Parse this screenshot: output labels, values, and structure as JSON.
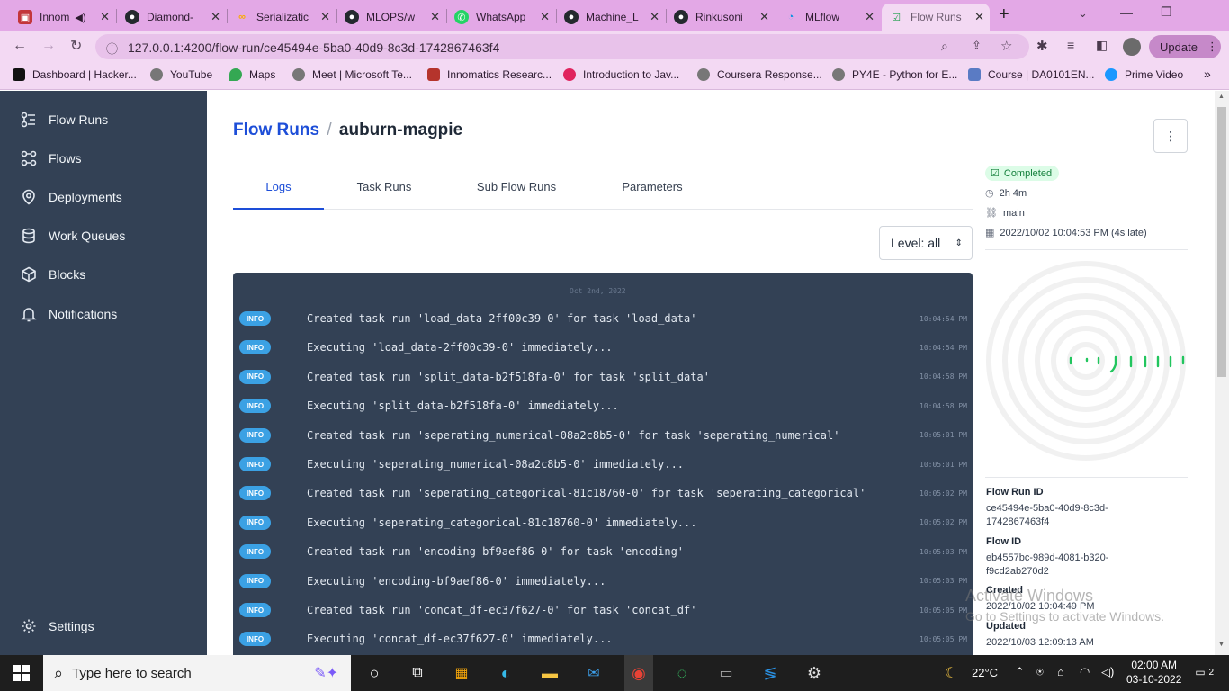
{
  "browser": {
    "tabs": [
      {
        "label": "Innom",
        "icon": "hackerrank-icon"
      },
      {
        "label": "Diamond-",
        "icon": "github-icon"
      },
      {
        "label": "Serializatic",
        "icon": "colab-icon"
      },
      {
        "label": "MLOPS/w",
        "icon": "github-icon"
      },
      {
        "label": "WhatsApp",
        "icon": "whatsapp-icon"
      },
      {
        "label": "Machine_L",
        "icon": "github-icon"
      },
      {
        "label": "Rinkusoni",
        "icon": "github-icon"
      },
      {
        "label": "MLflow",
        "icon": "mlflow-icon"
      },
      {
        "label": "Flow Runs",
        "icon": "prefect-icon"
      }
    ],
    "new_tab": "+",
    "url": "127.0.0.1:4200/flow-run/ce45494e-5ba0-40d9-8c3d-1742867463f4",
    "update_label": "Update",
    "bookmarks": [
      "Dashboard | Hacker...",
      "YouTube",
      "Maps",
      "Meet | Microsoft Te...",
      "Innomatics Researc...",
      "Introduction to Jav...",
      "Coursera Response...",
      "PY4E - Python for E...",
      "Course | DA0101EN...",
      "Prime Video"
    ],
    "bookmarks_more": "»"
  },
  "sidebar": {
    "items": [
      {
        "label": "Flow Runs",
        "icon": "flow-runs-icon"
      },
      {
        "label": "Flows",
        "icon": "flows-icon"
      },
      {
        "label": "Deployments",
        "icon": "deployments-icon"
      },
      {
        "label": "Work Queues",
        "icon": "work-queues-icon"
      },
      {
        "label": "Blocks",
        "icon": "blocks-icon"
      },
      {
        "label": "Notifications",
        "icon": "bell-icon"
      }
    ],
    "settings_label": "Settings"
  },
  "page": {
    "breadcrumb_root": "Flow Runs",
    "breadcrumb_sep": "/",
    "run_name": "auburn-magpie",
    "menu_icon": "⋮",
    "tabs": [
      "Logs",
      "Task Runs",
      "Sub Flow Runs",
      "Parameters"
    ],
    "level_select": "Level: all",
    "log_date": "Oct 2nd, 2022",
    "logs": [
      {
        "level": "INFO",
        "message": "Created task run 'load_data-2ff00c39-0' for task 'load_data'",
        "time": "10:04:54 PM"
      },
      {
        "level": "INFO",
        "message": "Executing 'load_data-2ff00c39-0' immediately...",
        "time": "10:04:54 PM"
      },
      {
        "level": "INFO",
        "message": "Created task run 'split_data-b2f518fa-0' for task 'split_data'",
        "time": "10:04:58 PM"
      },
      {
        "level": "INFO",
        "message": "Executing 'split_data-b2f518fa-0' immediately...",
        "time": "10:04:58 PM"
      },
      {
        "level": "INFO",
        "message": "Created task run 'seperating_numerical-08a2c8b5-0' for task 'seperating_numerical'",
        "time": "10:05:01 PM"
      },
      {
        "level": "INFO",
        "message": "Executing 'seperating_numerical-08a2c8b5-0' immediately...",
        "time": "10:05:01 PM"
      },
      {
        "level": "INFO",
        "message": "Created task run 'seperating_categorical-81c18760-0' for task 'seperating_categorical'",
        "time": "10:05:02 PM"
      },
      {
        "level": "INFO",
        "message": "Executing 'seperating_categorical-81c18760-0' immediately...",
        "time": "10:05:02 PM"
      },
      {
        "level": "INFO",
        "message": "Created task run 'encoding-bf9aef86-0' for task 'encoding'",
        "time": "10:05:03 PM"
      },
      {
        "level": "INFO",
        "message": "Executing 'encoding-bf9aef86-0' immediately...",
        "time": "10:05:03 PM"
      },
      {
        "level": "INFO",
        "message": "Created task run 'concat_df-ec37f627-0' for task 'concat_df'",
        "time": "10:05:05 PM"
      },
      {
        "level": "INFO",
        "message": "Executing 'concat_df-ec37f627-0' immediately...",
        "time": "10:05:05 PM"
      }
    ],
    "details": {
      "status": "Completed",
      "duration": "2h 4m",
      "work_queue": "main",
      "scheduled": "2022/10/02 10:04:53 PM (4s late)",
      "flow_run_id_label": "Flow Run ID",
      "flow_run_id_line1": "ce45494e-5ba0-40d9-8c3d-",
      "flow_run_id_line2": "1742867463f4",
      "flow_id_label": "Flow ID",
      "flow_id_line1": "eb4557bc-989d-4081-b320-",
      "flow_id_line2": "f9cd2ab270d2",
      "created_label": "Created",
      "created_value": "2022/10/02 10:04:49 PM",
      "updated_label": "Updated",
      "updated_value": "2022/10/03 12:09:13 AM"
    },
    "watermark_line1": "Activate Windows",
    "watermark_line2": "Go to Settings to activate Windows."
  },
  "taskbar": {
    "search_placeholder": "Type here to search",
    "weather": "22°C",
    "time": "02:00 AM",
    "date": "03-10-2022",
    "notifications": "2"
  },
  "colors": {
    "sidebar_bg": "#334155",
    "accent_blue": "#1d4ed8",
    "completed_green": "#16a34a",
    "log_bg": "#334155",
    "info_badge": "#3ba1e4",
    "browser_frame": "#e3a8e6"
  }
}
